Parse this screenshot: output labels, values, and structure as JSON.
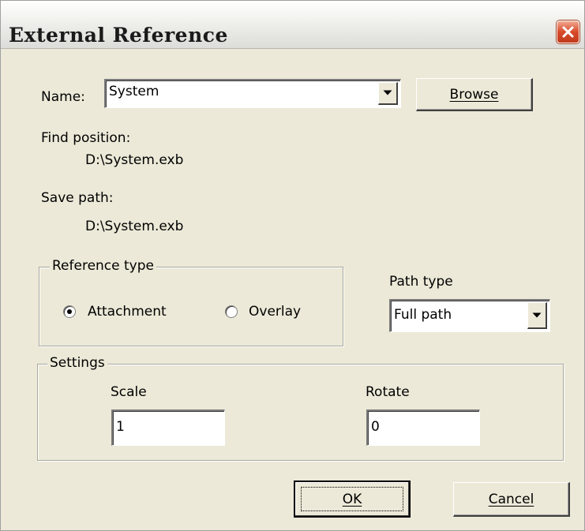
{
  "window": {
    "title": "External Reference",
    "close_icon": "close-icon"
  },
  "name": {
    "label": "Name:",
    "value": "System",
    "browse_label": "Browse"
  },
  "find_position": {
    "label": "Find position:",
    "value": "D:\\System.exb"
  },
  "save_path": {
    "label": "Save path:",
    "value": "D:\\System.exb"
  },
  "reference_type": {
    "title": "Reference type",
    "options": [
      {
        "label": "Attachment",
        "selected": true
      },
      {
        "label": "Overlay",
        "selected": false
      }
    ]
  },
  "path_type": {
    "label": "Path type",
    "value": "Full path"
  },
  "settings": {
    "title": "Settings",
    "scale_label": "Scale",
    "scale_value": "1",
    "rotate_label": "Rotate",
    "rotate_value": "0"
  },
  "buttons": {
    "ok": "OK",
    "cancel": "Cancel"
  }
}
